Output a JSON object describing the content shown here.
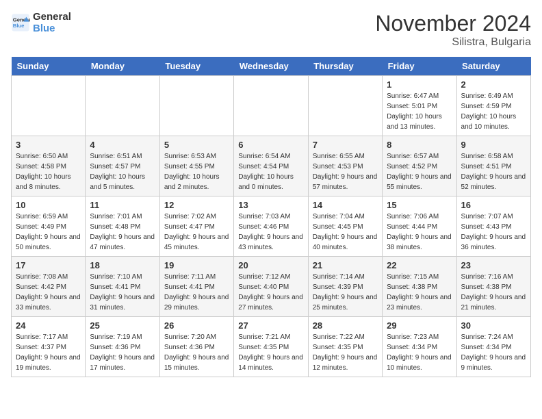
{
  "header": {
    "logo_line1": "General",
    "logo_line2": "Blue",
    "month": "November 2024",
    "location": "Silistra, Bulgaria"
  },
  "weekdays": [
    "Sunday",
    "Monday",
    "Tuesday",
    "Wednesday",
    "Thursday",
    "Friday",
    "Saturday"
  ],
  "weeks": [
    [
      {
        "day": "",
        "info": ""
      },
      {
        "day": "",
        "info": ""
      },
      {
        "day": "",
        "info": ""
      },
      {
        "day": "",
        "info": ""
      },
      {
        "day": "",
        "info": ""
      },
      {
        "day": "1",
        "info": "Sunrise: 6:47 AM\nSunset: 5:01 PM\nDaylight: 10 hours and 13 minutes."
      },
      {
        "day": "2",
        "info": "Sunrise: 6:49 AM\nSunset: 4:59 PM\nDaylight: 10 hours and 10 minutes."
      }
    ],
    [
      {
        "day": "3",
        "info": "Sunrise: 6:50 AM\nSunset: 4:58 PM\nDaylight: 10 hours and 8 minutes."
      },
      {
        "day": "4",
        "info": "Sunrise: 6:51 AM\nSunset: 4:57 PM\nDaylight: 10 hours and 5 minutes."
      },
      {
        "day": "5",
        "info": "Sunrise: 6:53 AM\nSunset: 4:55 PM\nDaylight: 10 hours and 2 minutes."
      },
      {
        "day": "6",
        "info": "Sunrise: 6:54 AM\nSunset: 4:54 PM\nDaylight: 10 hours and 0 minutes."
      },
      {
        "day": "7",
        "info": "Sunrise: 6:55 AM\nSunset: 4:53 PM\nDaylight: 9 hours and 57 minutes."
      },
      {
        "day": "8",
        "info": "Sunrise: 6:57 AM\nSunset: 4:52 PM\nDaylight: 9 hours and 55 minutes."
      },
      {
        "day": "9",
        "info": "Sunrise: 6:58 AM\nSunset: 4:51 PM\nDaylight: 9 hours and 52 minutes."
      }
    ],
    [
      {
        "day": "10",
        "info": "Sunrise: 6:59 AM\nSunset: 4:49 PM\nDaylight: 9 hours and 50 minutes."
      },
      {
        "day": "11",
        "info": "Sunrise: 7:01 AM\nSunset: 4:48 PM\nDaylight: 9 hours and 47 minutes."
      },
      {
        "day": "12",
        "info": "Sunrise: 7:02 AM\nSunset: 4:47 PM\nDaylight: 9 hours and 45 minutes."
      },
      {
        "day": "13",
        "info": "Sunrise: 7:03 AM\nSunset: 4:46 PM\nDaylight: 9 hours and 43 minutes."
      },
      {
        "day": "14",
        "info": "Sunrise: 7:04 AM\nSunset: 4:45 PM\nDaylight: 9 hours and 40 minutes."
      },
      {
        "day": "15",
        "info": "Sunrise: 7:06 AM\nSunset: 4:44 PM\nDaylight: 9 hours and 38 minutes."
      },
      {
        "day": "16",
        "info": "Sunrise: 7:07 AM\nSunset: 4:43 PM\nDaylight: 9 hours and 36 minutes."
      }
    ],
    [
      {
        "day": "17",
        "info": "Sunrise: 7:08 AM\nSunset: 4:42 PM\nDaylight: 9 hours and 33 minutes."
      },
      {
        "day": "18",
        "info": "Sunrise: 7:10 AM\nSunset: 4:41 PM\nDaylight: 9 hours and 31 minutes."
      },
      {
        "day": "19",
        "info": "Sunrise: 7:11 AM\nSunset: 4:41 PM\nDaylight: 9 hours and 29 minutes."
      },
      {
        "day": "20",
        "info": "Sunrise: 7:12 AM\nSunset: 4:40 PM\nDaylight: 9 hours and 27 minutes."
      },
      {
        "day": "21",
        "info": "Sunrise: 7:14 AM\nSunset: 4:39 PM\nDaylight: 9 hours and 25 minutes."
      },
      {
        "day": "22",
        "info": "Sunrise: 7:15 AM\nSunset: 4:38 PM\nDaylight: 9 hours and 23 minutes."
      },
      {
        "day": "23",
        "info": "Sunrise: 7:16 AM\nSunset: 4:38 PM\nDaylight: 9 hours and 21 minutes."
      }
    ],
    [
      {
        "day": "24",
        "info": "Sunrise: 7:17 AM\nSunset: 4:37 PM\nDaylight: 9 hours and 19 minutes."
      },
      {
        "day": "25",
        "info": "Sunrise: 7:19 AM\nSunset: 4:36 PM\nDaylight: 9 hours and 17 minutes."
      },
      {
        "day": "26",
        "info": "Sunrise: 7:20 AM\nSunset: 4:36 PM\nDaylight: 9 hours and 15 minutes."
      },
      {
        "day": "27",
        "info": "Sunrise: 7:21 AM\nSunset: 4:35 PM\nDaylight: 9 hours and 14 minutes."
      },
      {
        "day": "28",
        "info": "Sunrise: 7:22 AM\nSunset: 4:35 PM\nDaylight: 9 hours and 12 minutes."
      },
      {
        "day": "29",
        "info": "Sunrise: 7:23 AM\nSunset: 4:34 PM\nDaylight: 9 hours and 10 minutes."
      },
      {
        "day": "30",
        "info": "Sunrise: 7:24 AM\nSunset: 4:34 PM\nDaylight: 9 hours and 9 minutes."
      }
    ]
  ]
}
